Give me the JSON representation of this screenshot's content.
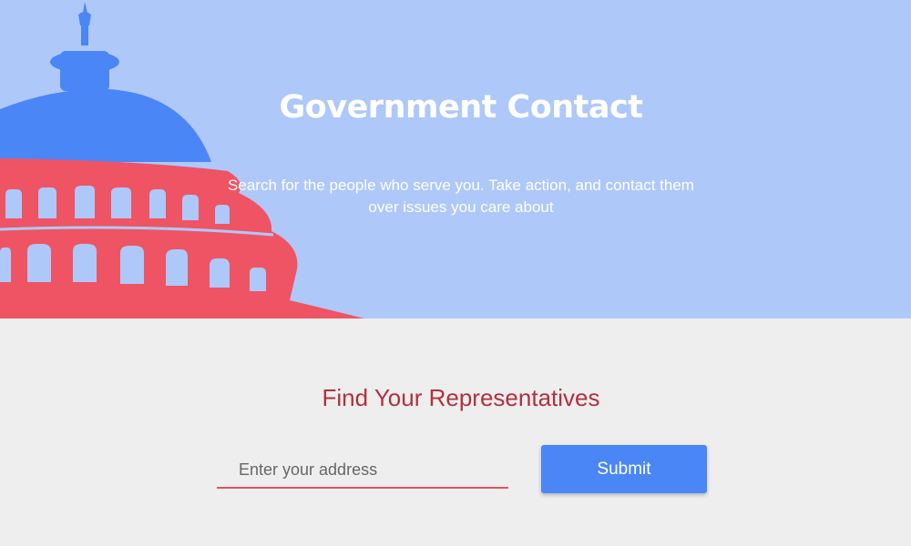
{
  "hero": {
    "title": "Government Contact",
    "subtitle": "Search for the people who serve you. Take action, and contact them over issues you care about",
    "illustration": "capitol-dome",
    "colors": {
      "background": "#aec8fa",
      "dome": "#4a86f5",
      "building": "#ef5464"
    }
  },
  "search": {
    "heading": "Find Your Representatives",
    "address_placeholder": "Enter your address",
    "address_value": "",
    "submit_label": "Submit",
    "colors": {
      "heading": "#b0313f",
      "underline": "#e0525f",
      "button": "#4a86f5"
    }
  }
}
